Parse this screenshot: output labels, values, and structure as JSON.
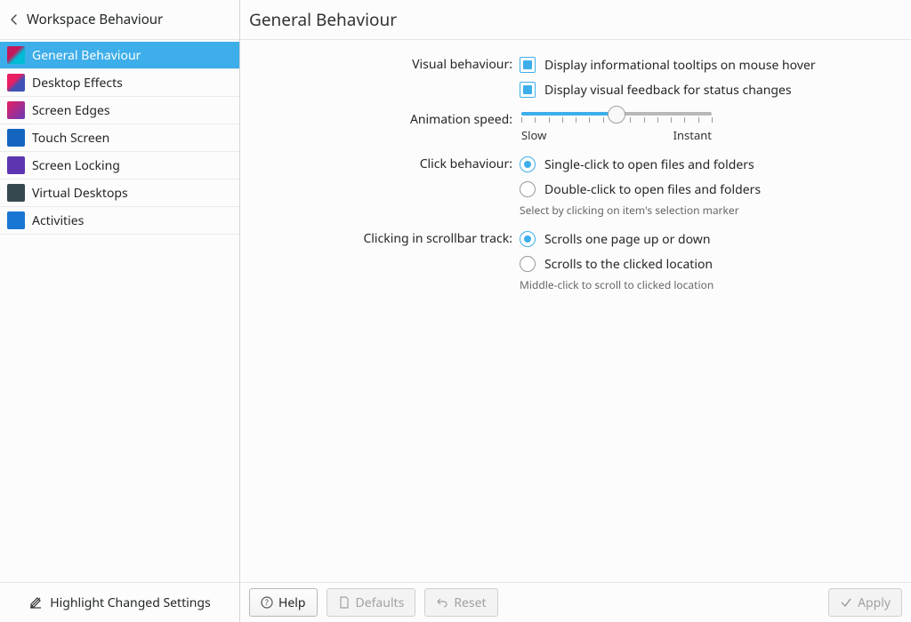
{
  "sidebar": {
    "header": "Workspace Behaviour",
    "items": [
      {
        "label": "General Behaviour",
        "icon": "general",
        "selected": true
      },
      {
        "label": "Desktop Effects",
        "icon": "effects"
      },
      {
        "label": "Screen Edges",
        "icon": "edges"
      },
      {
        "label": "Touch Screen",
        "icon": "touch"
      },
      {
        "label": "Screen Locking",
        "icon": "lock"
      },
      {
        "label": "Virtual Desktops",
        "icon": "vdesk"
      },
      {
        "label": "Activities",
        "icon": "act"
      }
    ],
    "footer_label": "Highlight Changed Settings"
  },
  "main": {
    "title": "General Behaviour",
    "visual_behaviour": {
      "label": "Visual behaviour:",
      "tooltips": {
        "label": "Display informational tooltips on mouse hover",
        "checked": true
      },
      "feedback": {
        "label": "Display visual feedback for status changes",
        "checked": true
      }
    },
    "animation_speed": {
      "label": "Animation speed:",
      "value_percent": 50,
      "ticks": 15,
      "slow_label": "Slow",
      "fast_label": "Instant"
    },
    "click_behaviour": {
      "label": "Click behaviour:",
      "single": {
        "label": "Single-click to open files and folders",
        "checked": true
      },
      "double": {
        "label": "Double-click to open files and folders",
        "checked": false
      },
      "hint": "Select by clicking on item's selection marker"
    },
    "scrollbar": {
      "label": "Clicking in scrollbar track:",
      "page": {
        "label": "Scrolls one page up or down",
        "checked": true
      },
      "location": {
        "label": "Scrolls to the clicked location",
        "checked": false
      },
      "hint": "Middle-click to scroll to clicked location"
    }
  },
  "footer": {
    "help": "Help",
    "defaults": "Defaults",
    "reset": "Reset",
    "apply": "Apply"
  }
}
